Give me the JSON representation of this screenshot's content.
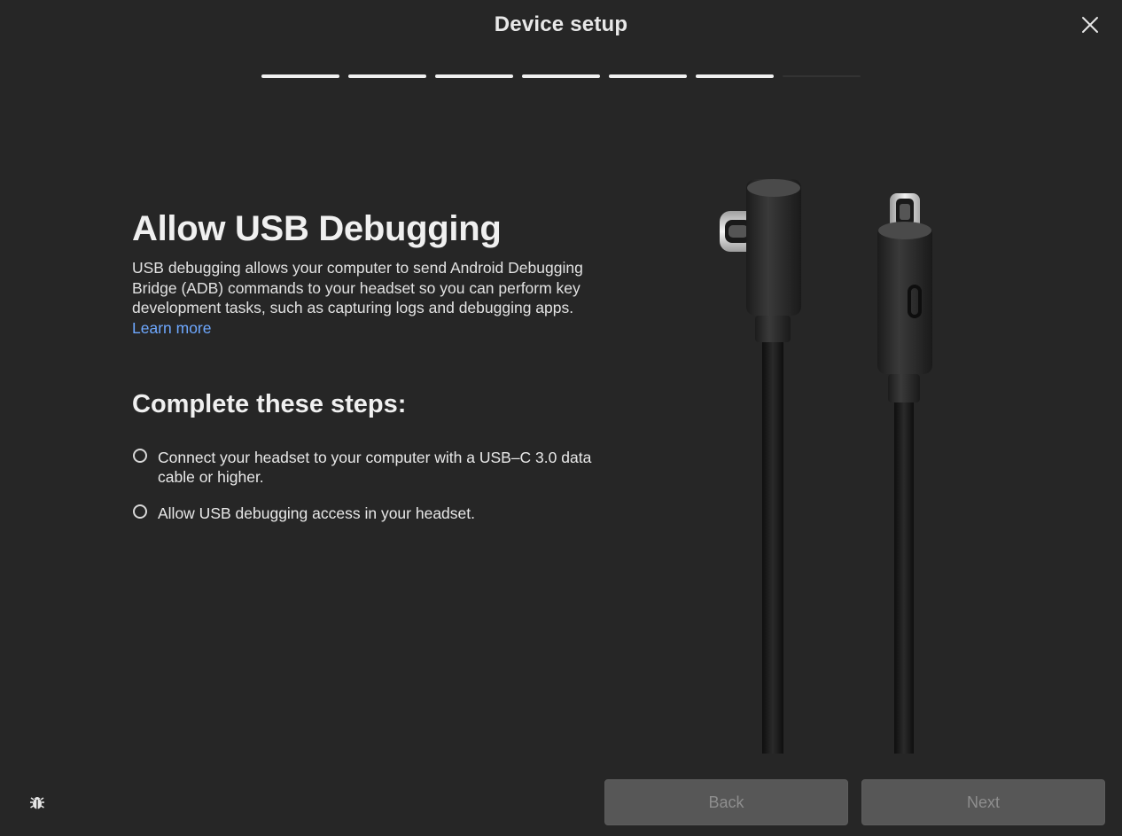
{
  "window": {
    "title": "Device setup",
    "close_icon": "close-icon"
  },
  "progress": {
    "total_steps": 7,
    "completed_steps": 6
  },
  "main": {
    "heading": "Allow USB Debugging",
    "description": "USB debugging allows your computer to send Android Debugging Bridge (ADB) commands to your headset so you can perform key development tasks, such as capturing logs and debugging apps.",
    "learn_more_label": "Learn more",
    "steps_heading": "Complete these steps:",
    "steps": [
      {
        "label": "Connect your headset to your computer with a USB–C 3.0 data cable or higher.",
        "checked": false
      },
      {
        "label": "Allow USB debugging access in your headset.",
        "checked": false
      }
    ],
    "illustration": "usb-c-cable-illustration"
  },
  "footer": {
    "bug_icon": "bug-icon",
    "back_label": "Back",
    "next_label": "Next",
    "back_enabled": false,
    "next_enabled": false
  },
  "colors": {
    "background": "#262626",
    "link": "#6ea8ff",
    "button_disabled_bg": "#575757",
    "button_disabled_text": "#8e8e8e"
  }
}
